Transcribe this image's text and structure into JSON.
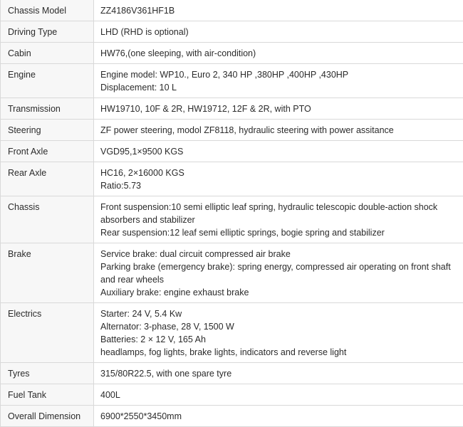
{
  "spec_table": {
    "rows": [
      {
        "label": "Chassis Model",
        "lines": [
          "ZZ4186V361HF1B"
        ]
      },
      {
        "label": "Driving Type",
        "lines": [
          "LHD (RHD is optional)"
        ]
      },
      {
        "label": "Cabin",
        "lines": [
          "HW76,(one sleeping, with air-condition)"
        ]
      },
      {
        "label": "Engine",
        "lines": [
          "Engine model: WP10., Euro 2, 340 HP ,380HP ,400HP ,430HP",
          "Displacement: 10 L"
        ]
      },
      {
        "label": "Transmission",
        "lines": [
          "HW19710, 10F & 2R, HW19712, 12F & 2R, with PTO"
        ]
      },
      {
        "label": "Steering",
        "lines": [
          "ZF power steering, modol ZF8118, hydraulic steering with power assitance"
        ]
      },
      {
        "label": "Front Axle",
        "lines": [
          "VGD95,1×9500 KGS"
        ]
      },
      {
        "label": "Rear Axle",
        "lines": [
          "HC16, 2×16000 KGS",
          "Ratio:5.73"
        ]
      },
      {
        "label": "Chassis",
        "lines": [
          "Front suspension:10 semi elliptic leaf spring, hydraulic telescopic double-action shock absorbers and stabilizer",
          "Rear suspension:12 leaf semi elliptic springs, bogie spring and stabilizer"
        ]
      },
      {
        "label": "Brake",
        "lines": [
          "Service brake: dual circuit compressed air brake",
          "Parking brake (emergency brake): spring energy, compressed air operating on front shaft and rear wheels",
          "Auxiliary brake: engine exhaust brake"
        ]
      },
      {
        "label": "Electrics",
        "lines": [
          "Starter: 24 V, 5.4 Kw",
          "Alternator: 3-phase, 28 V, 1500 W",
          "Batteries: 2 × 12 V, 165 Ah",
          "headlamps, fog lights, brake lights, indicators and reverse light"
        ]
      },
      {
        "label": "Tyres",
        "lines": [
          "315/80R22.5, with one spare tyre"
        ]
      },
      {
        "label": "Fuel Tank",
        "lines": [
          "400L"
        ]
      },
      {
        "label": "Overall Dimension",
        "lines": [
          "6900*2550*3450mm"
        ]
      }
    ]
  }
}
